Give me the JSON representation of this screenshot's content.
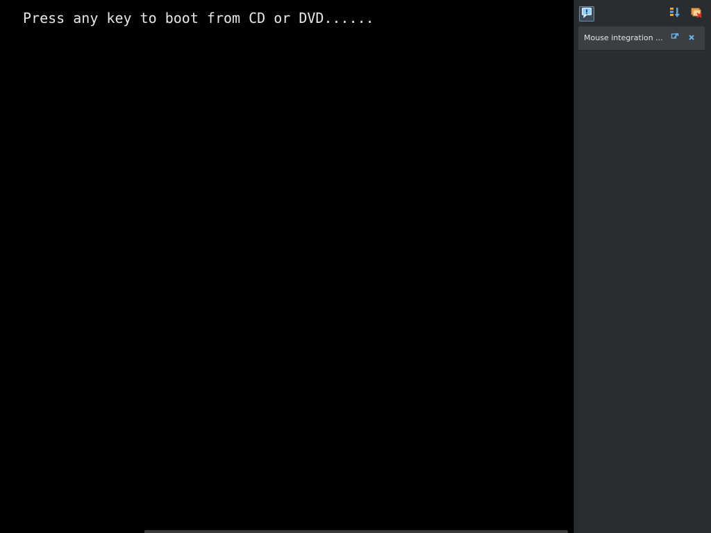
{
  "console": {
    "boot_message": "Press any key to boot from CD or DVD......"
  },
  "side_panel": {
    "toolbar": {
      "message_toggle_icon": "notification-message-icon",
      "sort_icon": "sort-order-icon",
      "dismiss_all_icon": "dismiss-all-icon"
    },
    "notifications": [
      {
        "text": "Mouse integration ...",
        "detach_icon": "detach-icon",
        "close_icon": "close-icon"
      }
    ]
  },
  "colors": {
    "console_bg": "#000000",
    "console_text": "#e8e8e8",
    "panel_bg": "#2a2d30",
    "notification_bg": "#3b3e42",
    "accent_blue": "#5aa9e6",
    "accent_orange": "#e8892a"
  }
}
